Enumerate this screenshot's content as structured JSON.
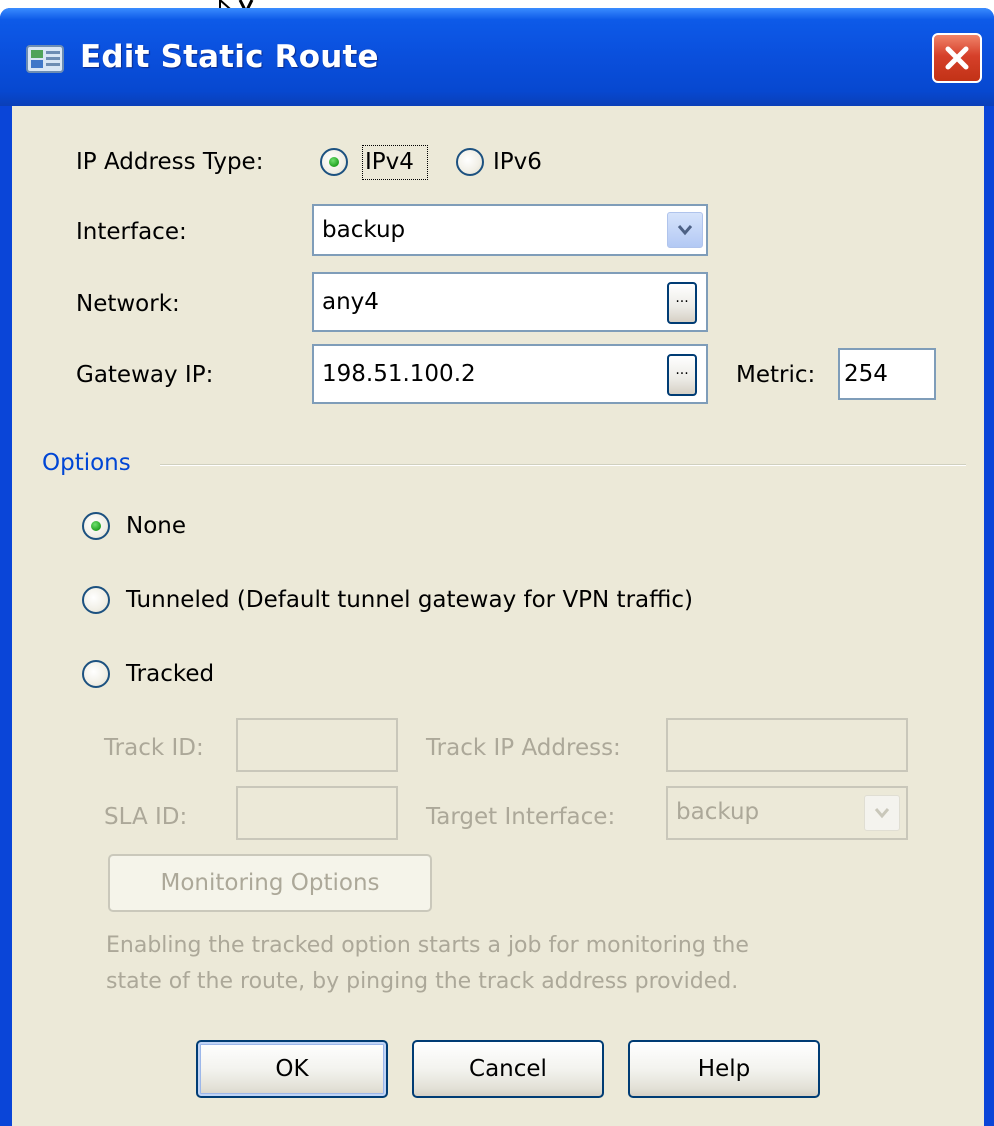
{
  "window": {
    "title": "Edit Static Route",
    "close_icon": "close-icon"
  },
  "ip_type": {
    "label": "IP Address Type:",
    "ipv4": "IPv4",
    "ipv6": "IPv6",
    "selected": "IPv4"
  },
  "interface": {
    "label": "Interface:",
    "value": "backup"
  },
  "network": {
    "label": "Network:",
    "value": "any4",
    "browse": "..."
  },
  "gateway": {
    "label": "Gateway IP:",
    "value": "198.51.100.2",
    "browse": "..."
  },
  "metric": {
    "label": "Metric:",
    "value": "254"
  },
  "options": {
    "title": "Options",
    "none": "None",
    "tunneled": "Tunneled (Default tunnel gateway for VPN traffic)",
    "tracked": "Tracked",
    "selected": "None"
  },
  "tracking": {
    "track_id_label": "Track ID:",
    "track_id_value": "",
    "track_ip_label": "Track IP Address:",
    "track_ip_value": "",
    "sla_id_label": "SLA ID:",
    "sla_id_value": "",
    "target_interface_label": "Target Interface:",
    "target_interface_value": "backup",
    "monitoring_button": "Monitoring Options",
    "note_line1": "Enabling the tracked option starts a job for monitoring the",
    "note_line2": "state of the route, by pinging the track address provided."
  },
  "buttons": {
    "ok": "OK",
    "cancel": "Cancel",
    "help": "Help"
  },
  "colors": {
    "title_bar": "#0a4fdc",
    "dialog_bg": "#ece9d8",
    "options_title": "#0046d5",
    "radio_selected": "#21a121",
    "disabled_text": "#aca899"
  }
}
